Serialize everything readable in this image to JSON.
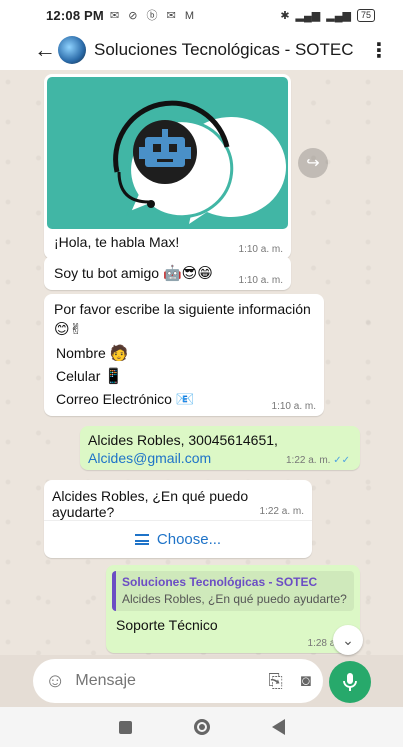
{
  "status_bar": {
    "time": "12:08 PM",
    "icons": "✉ ⊘ ⓑ ✉ M",
    "battery": "75"
  },
  "header": {
    "title": "Soluciones Tecnológicas - SOTEC"
  },
  "messages": [
    {
      "text": "¡Hola, te habla Max!",
      "time": "1:10 a. m."
    },
    {
      "text": "Soy tu bot amigo",
      "emoji": "🤖😎😁",
      "time": "1:10 a. m."
    },
    {
      "text": "Por favor escribe la siguiente información",
      "emoji": "😊✌",
      "lines": [
        {
          "label": "Nombre",
          "emoji": "🧑"
        },
        {
          "label": "Celular",
          "emoji": "📱"
        },
        {
          "label": "Correo Electrónico",
          "emoji": "📧"
        }
      ],
      "time": "1:10 a. m."
    },
    {
      "line1": "Alcides Robles, 30045614651,",
      "link": "Alcides@gmail.com",
      "time": "1:22 a. m."
    },
    {
      "text": "Alcides Robles, ¿En qué puedo ayudarte?",
      "time": "1:22 a. m.",
      "button": "Choose..."
    },
    {
      "quote_name": "Soluciones Tecnológicas - SOTEC",
      "quote_text": "Alcides Robles, ¿En qué puedo ayudarte?",
      "text": "Soporte Técnico",
      "time": "1:28 a. m."
    }
  ],
  "input": {
    "placeholder": "Mensaje"
  },
  "colors": {
    "accent": "#27a96b",
    "outgoing": "#dcf8c6",
    "image_bg": "#41b6a5",
    "link": "#1e73c8",
    "quote_name": "#6b4dc4"
  }
}
